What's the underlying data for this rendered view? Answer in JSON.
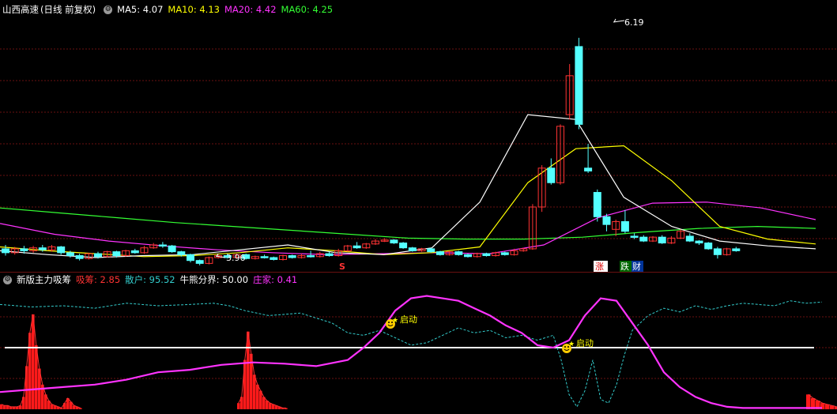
{
  "title": "山西高速",
  "title_suffix": "(日线 前复权)",
  "ma_legend": [
    {
      "label": "MA5:",
      "value": "4.07",
      "color": "#ffffff"
    },
    {
      "label": "MA10:",
      "value": "4.13",
      "color": "#ffff00"
    },
    {
      "label": "MA20:",
      "value": "4.42",
      "color": "#ff33ff"
    },
    {
      "label": "MA60:",
      "value": "4.25",
      "color": "#33ff33"
    }
  ],
  "indicator_name": "新版主力吸筹",
  "indicator_legend": [
    {
      "label": "吸筹:",
      "value": "2.85",
      "color": "#ff3333"
    },
    {
      "label": "散户:",
      "value": "95.52",
      "color": "#33cccc"
    },
    {
      "label": "牛熊分界:",
      "value": "50.00",
      "color": "#ffffff"
    },
    {
      "label": "庄家:",
      "value": "0.41",
      "color": "#ff33ff"
    }
  ],
  "annotations": {
    "high_label": "6.19",
    "low_label": "3.96",
    "marker_s": "S",
    "badge_zhang": "涨",
    "badge_die": "跌",
    "badge_cai": "财",
    "start_label_1": "启动",
    "start_label_2": "启动"
  },
  "colors": {
    "up": "#ff3333",
    "down": "#54ffff",
    "ma5": "#ffffff",
    "ma10": "#ffff00",
    "ma20": "#ff33ff",
    "ma60": "#33ff33",
    "grid": "#6a1010"
  },
  "chart_data": [
    {
      "type": "candlestick",
      "price_range": [
        3.8,
        6.4
      ],
      "candles": [
        {
          "o": 4.02,
          "c": 3.98,
          "h": 4.06,
          "l": 3.95
        },
        {
          "o": 3.98,
          "c": 4.02,
          "h": 4.04,
          "l": 3.96
        },
        {
          "o": 4.02,
          "c": 4.0,
          "h": 4.05,
          "l": 3.97
        },
        {
          "o": 4.0,
          "c": 4.03,
          "h": 4.05,
          "l": 3.98
        },
        {
          "o": 4.03,
          "c": 4.01,
          "h": 4.06,
          "l": 3.99
        },
        {
          "o": 4.01,
          "c": 4.04,
          "h": 4.06,
          "l": 3.99
        },
        {
          "o": 4.04,
          "c": 3.98,
          "h": 4.05,
          "l": 3.96
        },
        {
          "o": 3.98,
          "c": 3.95,
          "h": 4.0,
          "l": 3.93
        },
        {
          "o": 3.95,
          "c": 3.92,
          "h": 3.97,
          "l": 3.9
        },
        {
          "o": 3.92,
          "c": 3.97,
          "h": 3.98,
          "l": 3.91
        },
        {
          "o": 3.97,
          "c": 3.94,
          "h": 3.99,
          "l": 3.92
        },
        {
          "o": 3.94,
          "c": 3.99,
          "h": 4.0,
          "l": 3.93
        },
        {
          "o": 3.99,
          "c": 3.95,
          "h": 4.0,
          "l": 3.93
        },
        {
          "o": 3.95,
          "c": 4.0,
          "h": 4.01,
          "l": 3.94
        },
        {
          "o": 4.0,
          "c": 3.98,
          "h": 4.02,
          "l": 3.97
        },
        {
          "o": 3.98,
          "c": 4.03,
          "h": 4.05,
          "l": 3.97
        },
        {
          "o": 4.03,
          "c": 4.06,
          "h": 4.08,
          "l": 4.02
        },
        {
          "o": 4.06,
          "c": 4.05,
          "h": 4.09,
          "l": 4.03
        },
        {
          "o": 4.05,
          "c": 3.99,
          "h": 4.06,
          "l": 3.98
        },
        {
          "o": 3.99,
          "c": 3.96,
          "h": 4.0,
          "l": 3.94
        },
        {
          "o": 3.96,
          "c": 3.9,
          "h": 3.97,
          "l": 3.88
        },
        {
          "o": 3.9,
          "c": 3.87,
          "h": 3.91,
          "l": 3.85
        },
        {
          "o": 3.87,
          "c": 3.93,
          "h": 3.94,
          "l": 3.86
        },
        {
          "o": 3.93,
          "c": 3.95,
          "h": 3.96,
          "l": 3.92
        },
        {
          "o": 3.95,
          "c": 3.93,
          "h": 3.97,
          "l": 3.92
        },
        {
          "o": 3.93,
          "c": 3.96,
          "h": 3.97,
          "l": 3.92
        },
        {
          "o": 3.96,
          "c": 3.92,
          "h": 3.97,
          "l": 3.91
        },
        {
          "o": 3.92,
          "c": 3.94,
          "h": 3.95,
          "l": 3.91
        },
        {
          "o": 3.94,
          "c": 3.93,
          "h": 3.96,
          "l": 3.92
        },
        {
          "o": 3.93,
          "c": 3.91,
          "h": 3.94,
          "l": 3.9
        },
        {
          "o": 3.91,
          "c": 3.95,
          "h": 3.96,
          "l": 3.9
        },
        {
          "o": 3.95,
          "c": 3.93,
          "h": 3.96,
          "l": 3.92
        },
        {
          "o": 3.93,
          "c": 3.95,
          "h": 3.97,
          "l": 3.92
        },
        {
          "o": 3.95,
          "c": 3.94,
          "h": 4.0,
          "l": 3.93
        },
        {
          "o": 3.94,
          "c": 3.97,
          "h": 3.99,
          "l": 3.93
        },
        {
          "o": 3.97,
          "c": 3.95,
          "h": 3.99,
          "l": 3.94
        },
        {
          "o": 3.95,
          "c": 4.0,
          "h": 4.02,
          "l": 3.94
        },
        {
          "o": 4.0,
          "c": 4.05,
          "h": 4.06,
          "l": 3.99
        },
        {
          "o": 4.05,
          "c": 4.03,
          "h": 4.09,
          "l": 4.02
        },
        {
          "o": 4.03,
          "c": 4.07,
          "h": 4.08,
          "l": 4.02
        },
        {
          "o": 4.07,
          "c": 4.1,
          "h": 4.12,
          "l": 4.06
        },
        {
          "o": 4.1,
          "c": 4.11,
          "h": 4.13,
          "l": 4.09
        },
        {
          "o": 4.11,
          "c": 4.08,
          "h": 4.12,
          "l": 4.07
        },
        {
          "o": 4.08,
          "c": 4.03,
          "h": 4.09,
          "l": 4.02
        },
        {
          "o": 4.03,
          "c": 4.0,
          "h": 4.04,
          "l": 3.99
        },
        {
          "o": 4.0,
          "c": 4.02,
          "h": 4.03,
          "l": 3.99
        },
        {
          "o": 4.02,
          "c": 3.99,
          "h": 4.03,
          "l": 3.98
        },
        {
          "o": 3.99,
          "c": 3.96,
          "h": 4.0,
          "l": 3.95
        },
        {
          "o": 3.96,
          "c": 3.99,
          "h": 4.0,
          "l": 3.95
        },
        {
          "o": 3.99,
          "c": 3.96,
          "h": 4.0,
          "l": 3.95
        },
        {
          "o": 3.96,
          "c": 3.94,
          "h": 3.97,
          "l": 3.93
        },
        {
          "o": 3.94,
          "c": 3.97,
          "h": 3.98,
          "l": 3.93
        },
        {
          "o": 3.97,
          "c": 3.95,
          "h": 3.98,
          "l": 3.94
        },
        {
          "o": 3.95,
          "c": 3.98,
          "h": 3.99,
          "l": 3.94
        },
        {
          "o": 3.98,
          "c": 3.96,
          "h": 3.99,
          "l": 3.95
        },
        {
          "o": 3.96,
          "c": 4.0,
          "h": 4.02,
          "l": 3.95
        },
        {
          "o": 4.0,
          "c": 4.02,
          "h": 4.03,
          "l": 3.99
        },
        {
          "o": 4.02,
          "c": 4.45,
          "h": 4.48,
          "l": 4.01
        },
        {
          "o": 4.45,
          "c": 4.85,
          "h": 4.88,
          "l": 4.4
        },
        {
          "o": 4.85,
          "c": 4.7,
          "h": 4.95,
          "l": 4.68
        },
        {
          "o": 4.7,
          "c": 5.28,
          "h": 5.3,
          "l": 4.68
        },
        {
          "o": 5.4,
          "c": 5.8,
          "h": 5.92,
          "l": 5.35
        },
        {
          "o": 6.1,
          "c": 5.3,
          "h": 6.19,
          "l": 5.25
        },
        {
          "o": 4.85,
          "c": 4.82,
          "h": 5.1,
          "l": 4.8
        },
        {
          "o": 4.6,
          "c": 4.35,
          "h": 4.63,
          "l": 4.3
        },
        {
          "o": 4.35,
          "c": 4.27,
          "h": 4.38,
          "l": 4.2
        },
        {
          "o": 4.22,
          "c": 4.3,
          "h": 4.32,
          "l": 4.15
        },
        {
          "o": 4.3,
          "c": 4.2,
          "h": 4.42,
          "l": 4.18
        },
        {
          "o": 4.15,
          "c": 4.14,
          "h": 4.18,
          "l": 4.12
        },
        {
          "o": 4.14,
          "c": 4.1,
          "h": 4.16,
          "l": 4.09
        },
        {
          "o": 4.1,
          "c": 4.14,
          "h": 4.15,
          "l": 4.09
        },
        {
          "o": 4.14,
          "c": 4.08,
          "h": 4.16,
          "l": 4.07
        },
        {
          "o": 4.08,
          "c": 4.13,
          "h": 4.15,
          "l": 4.07
        },
        {
          "o": 4.13,
          "c": 4.2,
          "h": 4.22,
          "l": 4.12
        },
        {
          "o": 4.15,
          "c": 4.1,
          "h": 4.18,
          "l": 4.09
        },
        {
          "o": 4.1,
          "c": 4.08,
          "h": 4.11,
          "l": 4.06
        },
        {
          "o": 4.08,
          "c": 4.02,
          "h": 4.09,
          "l": 4.01
        },
        {
          "o": 4.02,
          "c": 3.96,
          "h": 4.04,
          "l": 3.92
        },
        {
          "o": 3.96,
          "c": 4.02,
          "h": 4.03,
          "l": 3.95
        },
        {
          "o": 4.02,
          "c": 4.0,
          "h": 4.04,
          "l": 3.99
        }
      ],
      "ma_series": [
        {
          "key": "ma60",
          "values": [
            4.44,
            4.39,
            4.34,
            4.29,
            4.25,
            4.21,
            4.17,
            4.13,
            4.12,
            4.12,
            4.14,
            4.19,
            4.23,
            4.25,
            4.23
          ]
        },
        {
          "key": "ma20",
          "values": [
            4.28,
            4.17,
            4.1,
            4.05,
            4.01,
            3.98,
            3.96,
            3.97,
            3.98,
            3.97,
            4.06,
            4.34,
            4.49,
            4.5,
            4.44,
            4.32
          ]
        },
        {
          "key": "ma10",
          "values": [
            4.04,
            4.0,
            3.97,
            3.94,
            3.95,
            3.98,
            4.03,
            4.0,
            3.96,
            3.98,
            4.04,
            4.7,
            5.05,
            5.08,
            4.72,
            4.25,
            4.12,
            4.07
          ]
        },
        {
          "key": "ma5",
          "values": [
            4.0,
            3.96,
            3.93,
            3.95,
            3.96,
            4.01,
            4.06,
            3.98,
            3.96,
            4.03,
            4.5,
            5.4,
            5.35,
            4.55,
            4.25,
            4.1,
            4.05,
            4.02
          ]
        }
      ]
    },
    {
      "type": "indicator",
      "y_range": [
        0,
        100
      ],
      "reference_line": 50,
      "bars_x": [
        0,
        4,
        8,
        12,
        16,
        20,
        24,
        28,
        32,
        36,
        40,
        44,
        48,
        52,
        56,
        60,
        64,
        68,
        72,
        76,
        80,
        84,
        88,
        92,
        96,
        100
      ],
      "bars": [
        4,
        3,
        3,
        2,
        2,
        2,
        3,
        10,
        35,
        62,
        77,
        52,
        33,
        20,
        12,
        7,
        4,
        3,
        2,
        1,
        5,
        9,
        6,
        3,
        2,
        1
      ],
      "bars2_x": [
        300,
        304,
        308,
        312,
        316,
        320,
        324,
        328,
        332,
        336,
        340,
        344,
        348,
        352,
        356,
        360
      ],
      "bars2": [
        5,
        10,
        40,
        63,
        45,
        28,
        20,
        15,
        10,
        7,
        5,
        4,
        3,
        2,
        1,
        1
      ],
      "bars3_x": [
        1020,
        1026,
        1032,
        1038,
        1044,
        1050,
        1056
      ],
      "bars3": [
        12,
        9,
        7,
        5,
        4,
        3,
        2
      ],
      "retail_x": [
        0,
        40,
        80,
        120,
        160,
        200,
        240,
        270,
        290,
        310,
        340,
        380,
        420,
        440,
        460,
        480,
        500,
        520,
        540,
        560,
        580,
        600,
        620,
        640,
        660,
        680,
        700,
        710,
        720,
        730,
        740,
        750,
        760,
        770,
        780,
        790,
        800,
        820,
        840,
        860,
        880,
        900,
        920,
        940,
        960,
        980,
        1000,
        1020,
        1040
      ],
      "retail": [
        85,
        83,
        84,
        82,
        86,
        84,
        85,
        86,
        84,
        80,
        76,
        78,
        70,
        62,
        60,
        64,
        58,
        52,
        54,
        60,
        66,
        62,
        64,
        58,
        60,
        56,
        60,
        40,
        12,
        2,
        15,
        40,
        8,
        5,
        20,
        44,
        64,
        76,
        82,
        79,
        84,
        81,
        84,
        86,
        85,
        84,
        88,
        86,
        87
      ],
      "mm_x": [
        0,
        40,
        80,
        120,
        160,
        200,
        240,
        280,
        320,
        360,
        400,
        440,
        460,
        480,
        500,
        520,
        540,
        560,
        580,
        600,
        620,
        640,
        660,
        680,
        700,
        720,
        740,
        760,
        780,
        800,
        820,
        840,
        860,
        880,
        900,
        920,
        940,
        960,
        980,
        1000,
        1040
      ],
      "mm": [
        14,
        16,
        18,
        20,
        24,
        30,
        32,
        36,
        38,
        37,
        35,
        40,
        50,
        62,
        80,
        90,
        92,
        90,
        88,
        82,
        76,
        68,
        62,
        52,
        50,
        56,
        76,
        90,
        88,
        70,
        52,
        30,
        18,
        10,
        5,
        2,
        1,
        1,
        1,
        1,
        1
      ]
    }
  ]
}
